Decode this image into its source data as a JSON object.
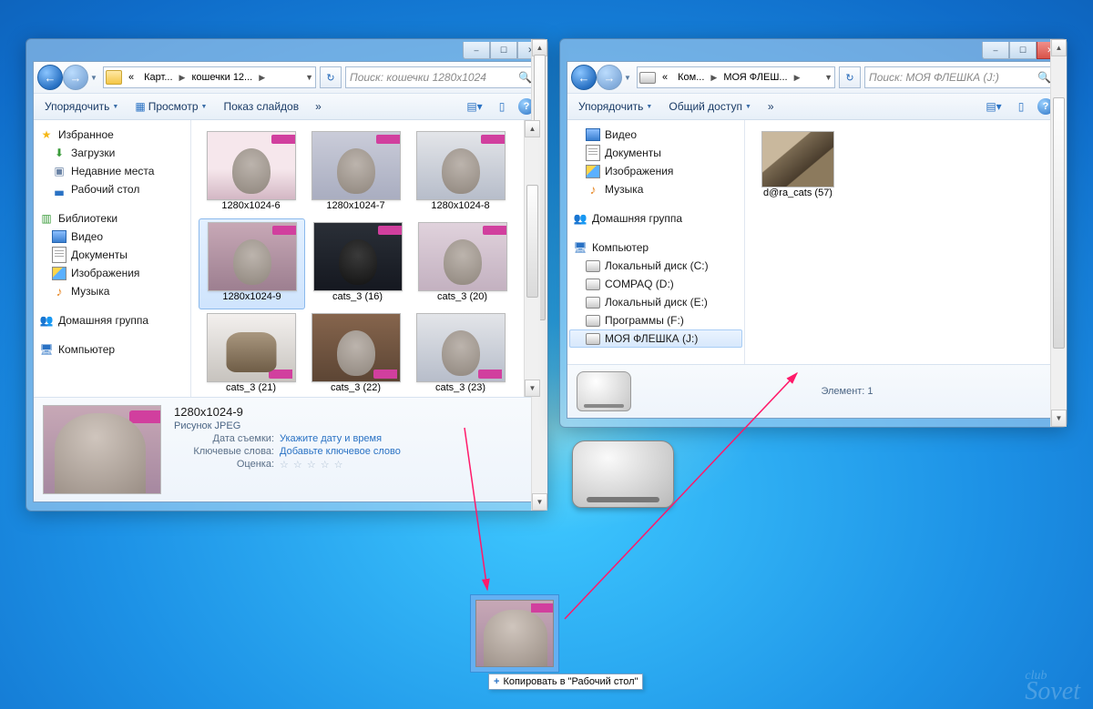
{
  "win1": {
    "title_controls": {
      "min": "–",
      "max": "☐",
      "close": "✕"
    },
    "address": {
      "prefix": "«",
      "seg1": "Карт...",
      "seg2": "кошечки 12...",
      "refresh": "↻"
    },
    "search": {
      "placeholder": "Поиск: кошечки 1280x1024"
    },
    "toolbar": {
      "organize": "Упорядочить",
      "preview": "Просмотр",
      "slideshow": "Показ слайдов",
      "more": "»"
    },
    "nav": {
      "favorites": "Избранное",
      "downloads": "Загрузки",
      "recent": "Недавние места",
      "desktop": "Рабочий стол",
      "libraries": "Библиотеки",
      "videos": "Видео",
      "documents": "Документы",
      "pictures": "Изображения",
      "music": "Музыка",
      "homegroup": "Домашняя группа",
      "computer": "Компьютер"
    },
    "files": [
      "1280x1024-6",
      "1280x1024-7",
      "1280x1024-8",
      "1280x1024-9",
      "cats_3 (16)",
      "cats_3 (20)",
      "cats_3 (21)",
      "cats_3 (22)",
      "cats_3 (23)"
    ],
    "details": {
      "name": "1280x1024-9",
      "type": "Рисунок JPEG",
      "date_label": "Дата съемки:",
      "date_value": "Укажите дату и время",
      "tags_label": "Ключевые слова:",
      "tags_value": "Добавьте ключевое слово",
      "rating_label": "Оценка:"
    }
  },
  "win2": {
    "title_controls": {
      "min": "–",
      "max": "☐",
      "close": "✕"
    },
    "address": {
      "prefix": "«",
      "seg1": "Ком...",
      "seg2": "МОЯ ФЛЕШ...",
      "refresh": "↻"
    },
    "search": {
      "placeholder": "Поиск: МОЯ ФЛЕШКА (J:)"
    },
    "toolbar": {
      "organize": "Упорядочить",
      "share": "Общий доступ",
      "more": "»"
    },
    "nav": {
      "videos": "Видео",
      "documents": "Документы",
      "pictures": "Изображения",
      "music": "Музыка",
      "homegroup": "Домашняя группа",
      "computer": "Компьютер",
      "drive_c": "Локальный диск (C:)",
      "drive_d": "COMPAQ (D:)",
      "drive_e": "Локальный диск (E:)",
      "drive_f": "Программы  (F:)",
      "drive_j": "МОЯ ФЛЕШКА (J:)"
    },
    "files": [
      "d@ra_cats (57)"
    ],
    "status": {
      "label": "Элемент: 1"
    }
  },
  "drag": {
    "tooltip": "Копировать в \"Рабочий стол\""
  },
  "watermark": {
    "top": "club",
    "bottom": "Sovet"
  }
}
